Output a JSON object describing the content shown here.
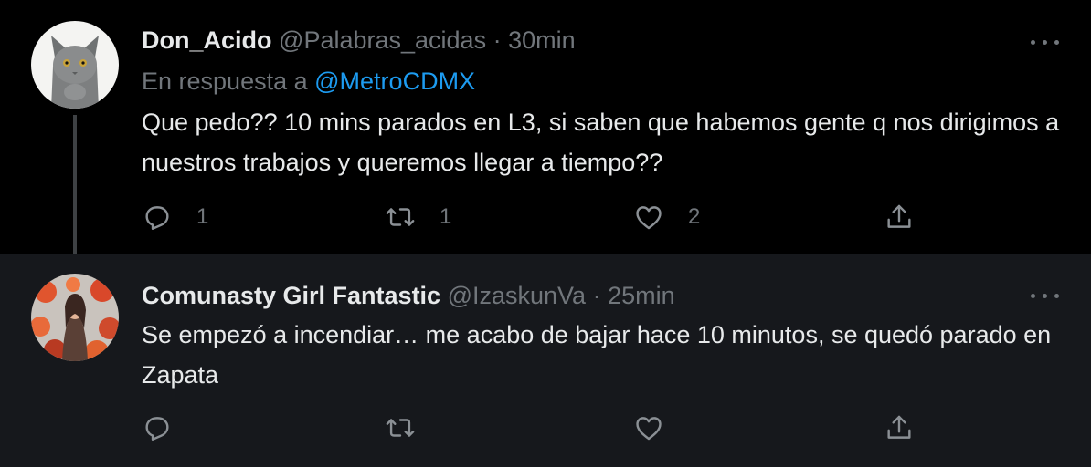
{
  "tweets": [
    {
      "name": "Don_Acido",
      "handle": "@Palabras_acidas",
      "separator": "·",
      "time": "30min",
      "reply_prefix": "En respuesta a",
      "reply_mention": "@MetroCDMX",
      "text": "Que pedo?? 10 mins parados en L3, si saben que habemos gente q nos dirigimos a nuestros trabajos y queremos llegar a tiempo??",
      "replies": "1",
      "retweets": "1",
      "likes": "2"
    },
    {
      "name": "Comunasty Girl Fantastic",
      "handle": "@IzaskunVa",
      "separator": "·",
      "time": "25min",
      "text": "Se empezó a incendiar… me acabo de bajar hace 10 minutos, se quedó parado en Zapata",
      "replies": "",
      "retweets": "",
      "likes": ""
    }
  ],
  "icons": {
    "reply": "reply-icon",
    "retweet": "retweet-icon",
    "like": "heart-icon",
    "share": "share-icon",
    "more": "more-options-icon"
  },
  "colors": {
    "background": "#000000",
    "reply_background": "#16181c",
    "text": "#e7e9ea",
    "secondary": "#71767b",
    "accent": "#1d9bf0"
  }
}
